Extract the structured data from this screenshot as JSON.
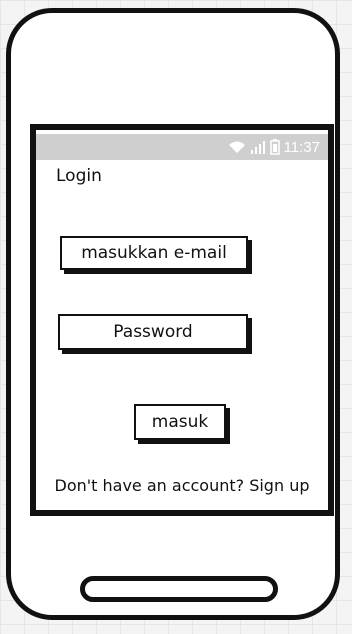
{
  "status_bar": {
    "time": "11:37",
    "icons": [
      "wifi-icon",
      "signal-icon",
      "battery-icon"
    ]
  },
  "screen": {
    "title": "Login",
    "email_placeholder": "masukkan e-mail",
    "password_placeholder": "Password",
    "login_button_label": "masuk",
    "signup_text": "Don't have an account? Sign up"
  },
  "colors": {
    "frame": "#111111",
    "status_bar_bg": "#cfcfcf",
    "status_bar_text": "#ffffff"
  }
}
